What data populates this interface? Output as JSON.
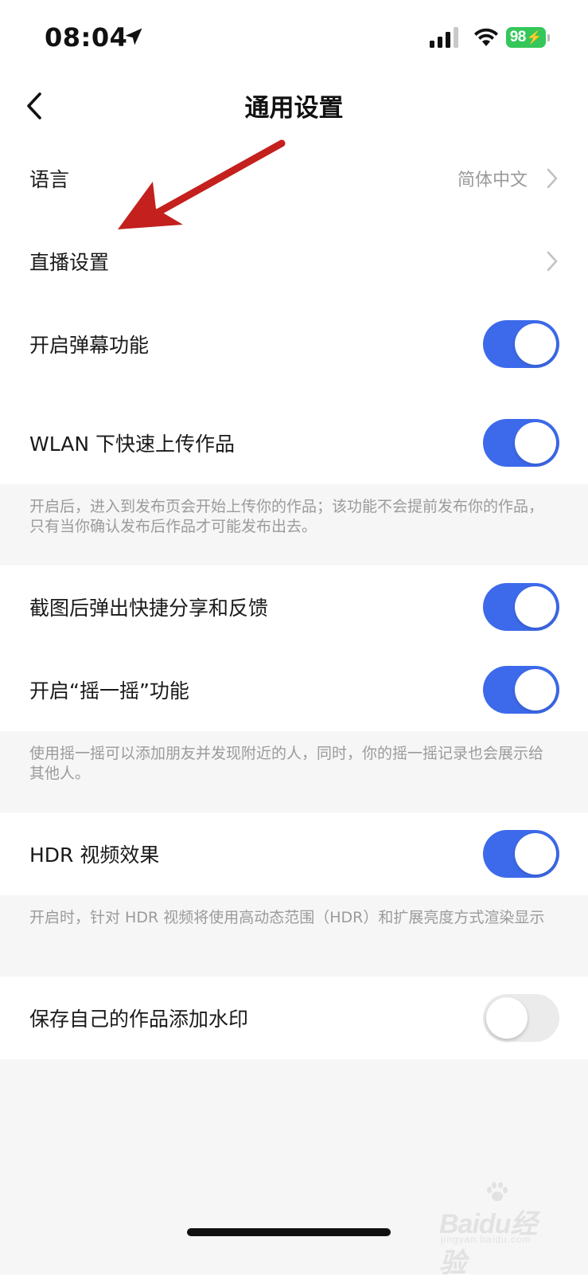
{
  "status_bar": {
    "time": "08:04",
    "battery": "98",
    "location_icon": "location-arrow-icon",
    "signal_icon": "cellular-signal-icon",
    "wifi_icon": "wifi-icon",
    "battery_icon": "battery-charging-icon"
  },
  "nav": {
    "title": "通用设置",
    "back_icon": "chevron-left-icon"
  },
  "settings": {
    "language": {
      "label": "语言",
      "value": "简体中文"
    },
    "live": {
      "label": "直播设置"
    },
    "danmaku": {
      "label": "开启弹幕功能",
      "on": true
    },
    "wlan_upload": {
      "label": "WLAN 下快速上传作品",
      "on": true,
      "note": "开启后，进入到发布页会开始上传你的作品；该功能不会提前发布你的作品，只有当你确认发布后作品才可能发布出去。"
    },
    "screenshot_share": {
      "label": "截图后弹出快捷分享和反馈",
      "on": true
    },
    "shake": {
      "label": "开启“摇一摇”功能",
      "on": true,
      "note": "使用摇一摇可以添加朋友并发现附近的人，同时，你的摇一摇记录也会展示给其他人。"
    },
    "hdr": {
      "label": "HDR 视频效果",
      "on": true,
      "note": "开启时，针对 HDR 视频将使用高动态范围（HDR）和扩展亮度方式渲染显示"
    },
    "watermark_save": {
      "label": "保存自己的作品添加水印",
      "on": false
    }
  },
  "watermark": {
    "logo": "Baidu经验",
    "sub": "jingyan.baidu.com"
  },
  "colors": {
    "toggle_on": "#3d6aeb",
    "toggle_off": "#ebebeb",
    "annotation_arrow": "#c4201d",
    "note_background": "#f6f6f6"
  }
}
